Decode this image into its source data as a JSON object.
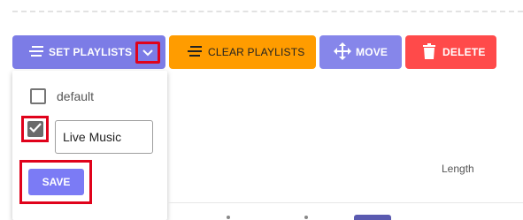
{
  "toolbar": {
    "set_playlists": {
      "label": "SET PLAYLISTS",
      "icon": "list-icon"
    },
    "dropdown_toggle": {
      "icon": "chevron-down-icon"
    },
    "clear_playlists": {
      "label": "CLEAR PLAYLISTS",
      "icon": "list-icon"
    },
    "move": {
      "label": "MOVE",
      "icon": "move-arrows-icon"
    },
    "delete": {
      "label": "DELETE",
      "icon": "trash-icon"
    }
  },
  "dropdown": {
    "options": [
      {
        "label": "default",
        "checked": false
      }
    ],
    "new_playlist": {
      "checked": true,
      "value": "Live Music"
    },
    "save_label": "SAVE"
  },
  "table": {
    "length_header": "Length"
  },
  "colors": {
    "set_playlists": "#7c7ce6",
    "clear_playlists": "#ff9c00",
    "move": "#8686ea",
    "delete": "#ff4a4a",
    "save": "#7b7bf5",
    "highlight": "#e0021b"
  }
}
